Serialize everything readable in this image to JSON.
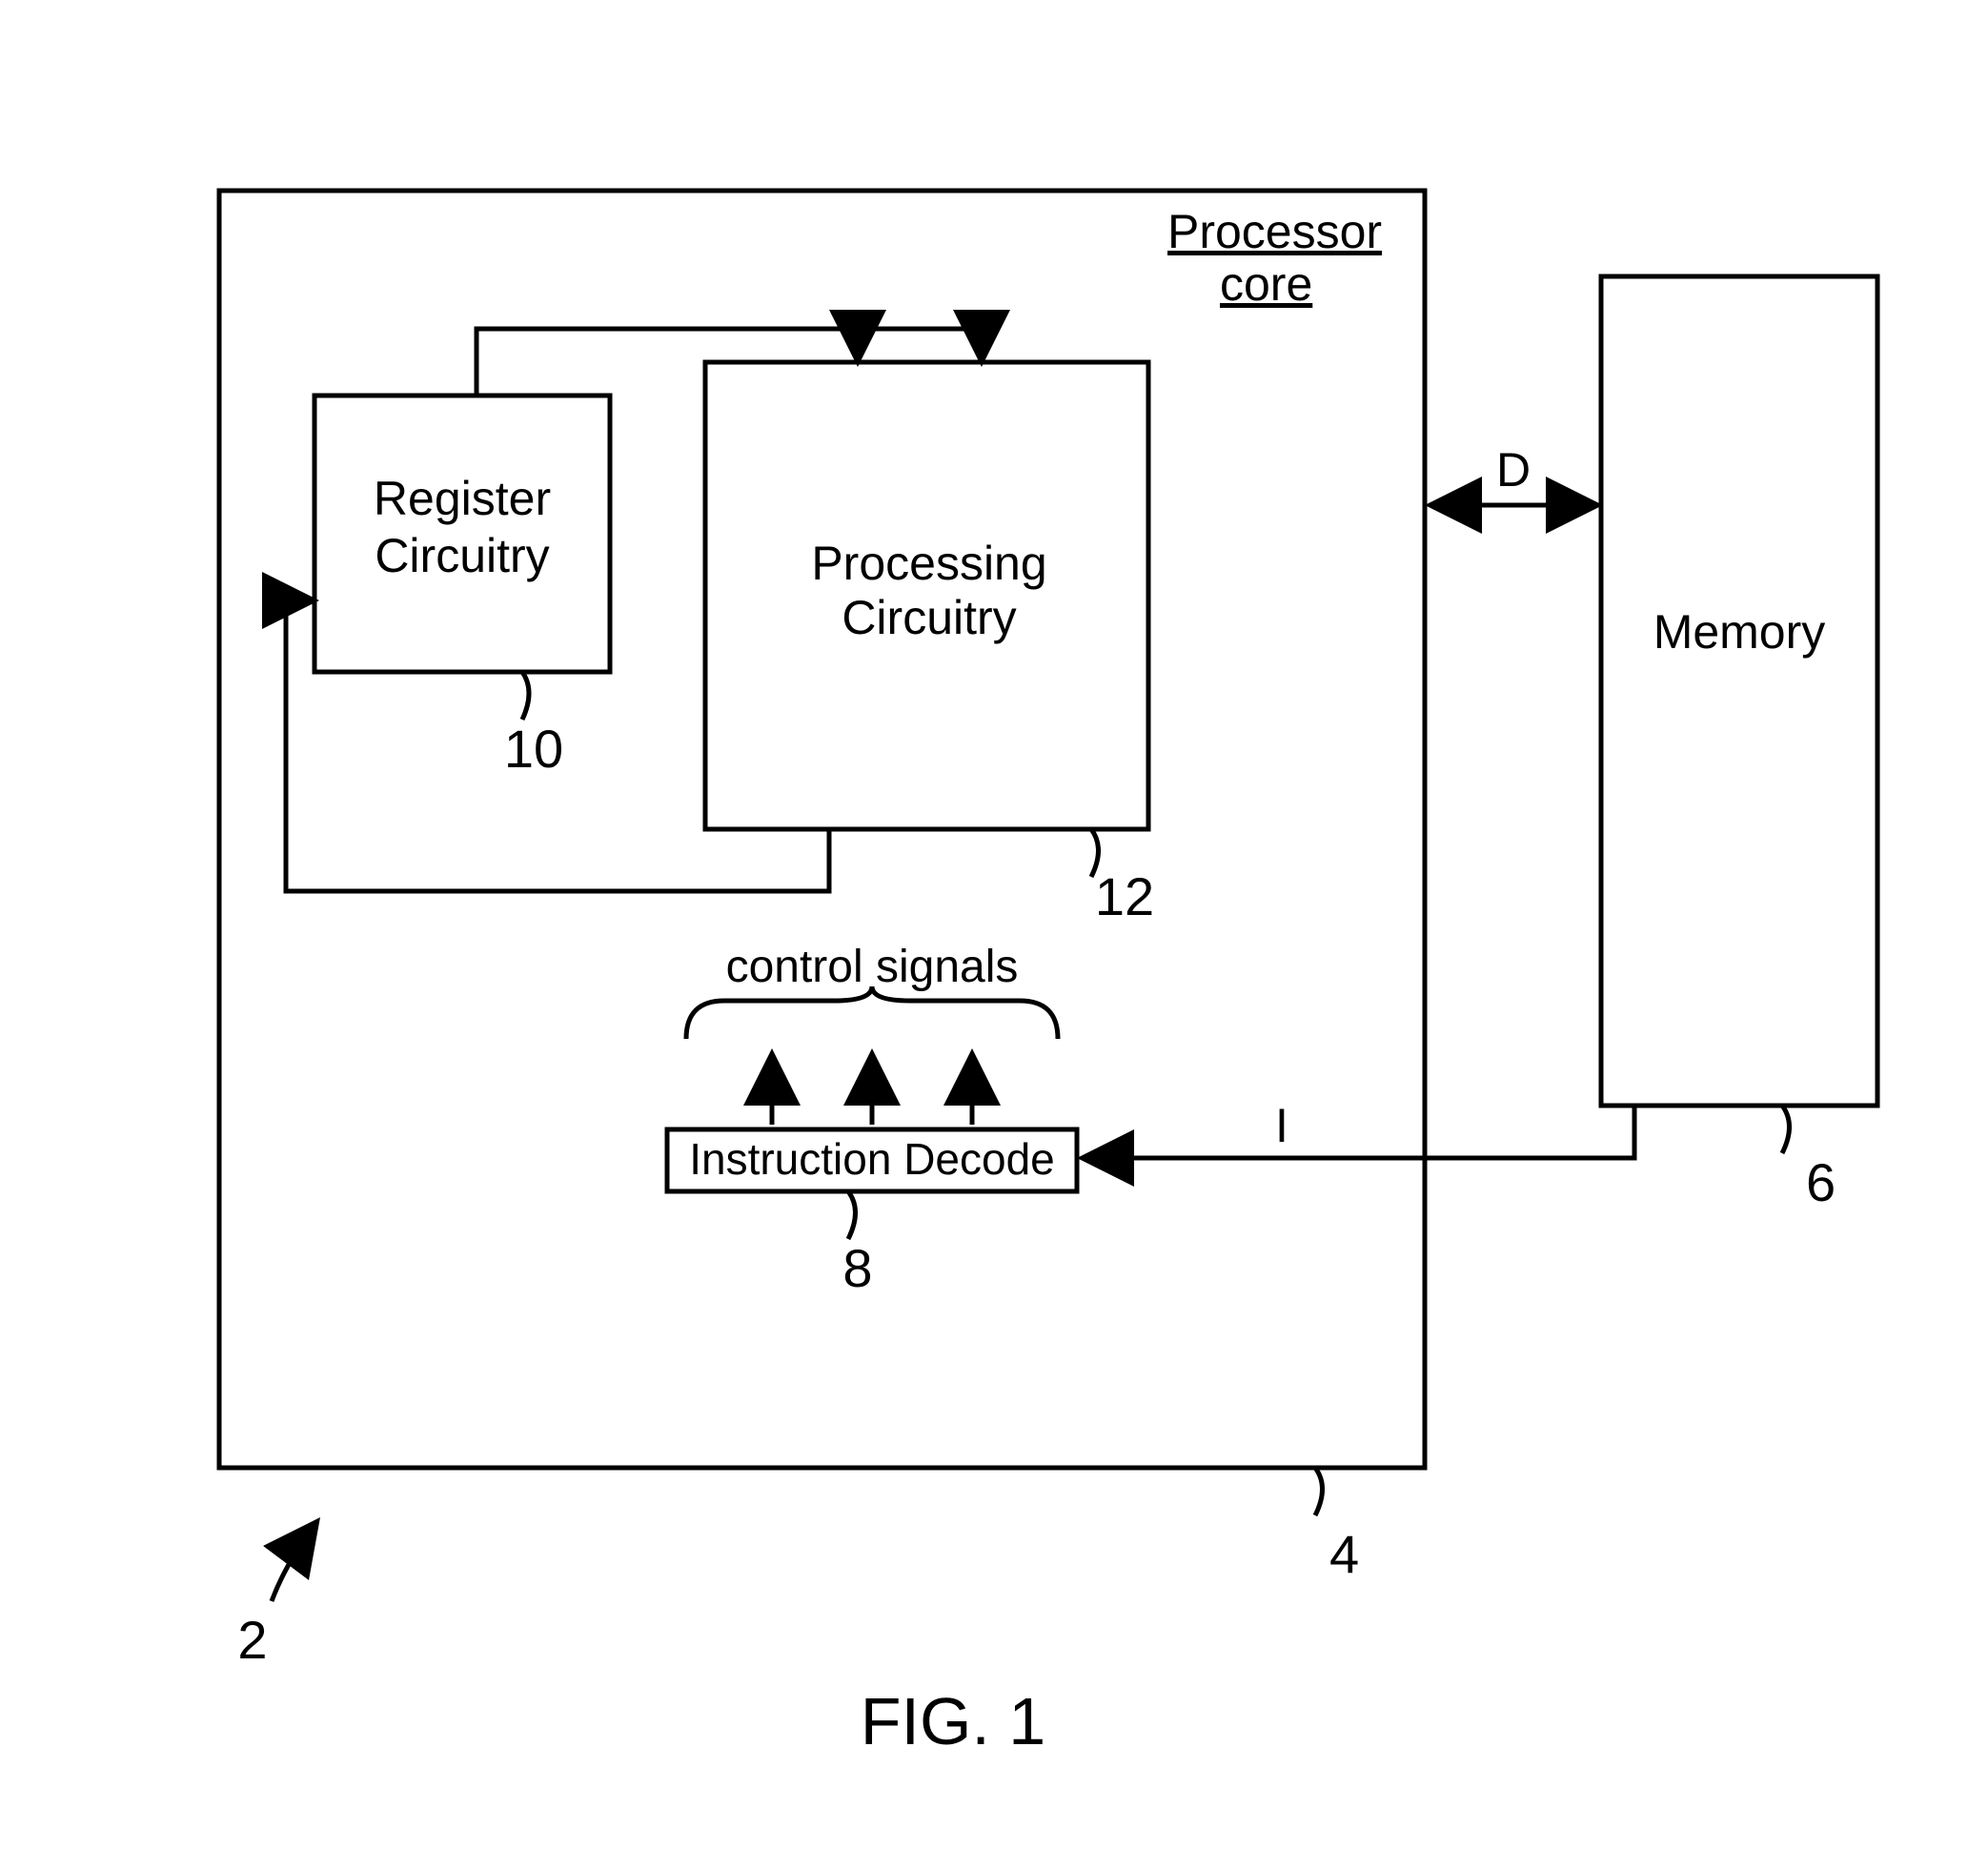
{
  "diagram": {
    "core_label_line1": "Processor",
    "core_label_line2": "core",
    "register_label_line1": "Register",
    "register_label_line2": "Circuitry",
    "processing_label_line1": "Processing",
    "processing_label_line2": "Circuitry",
    "memory_label": "Memory",
    "decode_label": "Instruction Decode",
    "control_signals_label": "control signals",
    "data_bus_label": "D",
    "instruction_bus_label": "I",
    "ref_core": "4",
    "ref_memory": "6",
    "ref_decode": "8",
    "ref_register": "10",
    "ref_processing": "12",
    "ref_system": "2",
    "figure_label": "FIG. 1"
  }
}
